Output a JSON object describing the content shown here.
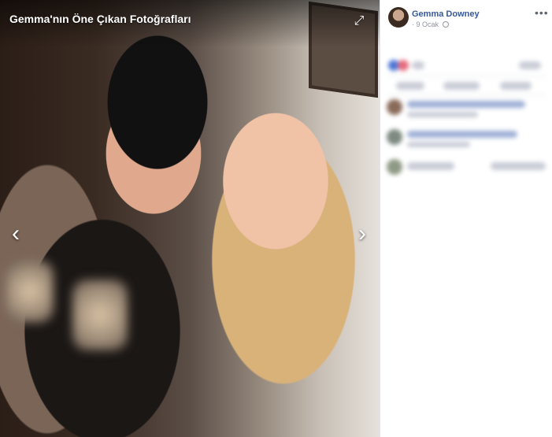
{
  "viewer": {
    "title": "Gemma'nın Öne Çıkan Fotoğrafları",
    "expand_icon": "expand-icon",
    "prev_icon": "chevron-left-icon",
    "next_icon": "chevron-right-icon"
  },
  "post": {
    "author": "Gemma Downey",
    "date": "9 Ocak",
    "separator": "·",
    "privacy_icon": "globe-icon",
    "more_label": "•••"
  },
  "colors": {
    "link_blue": "#385898",
    "meta_gray": "#90949c",
    "panel_bg": "#ffffff"
  }
}
